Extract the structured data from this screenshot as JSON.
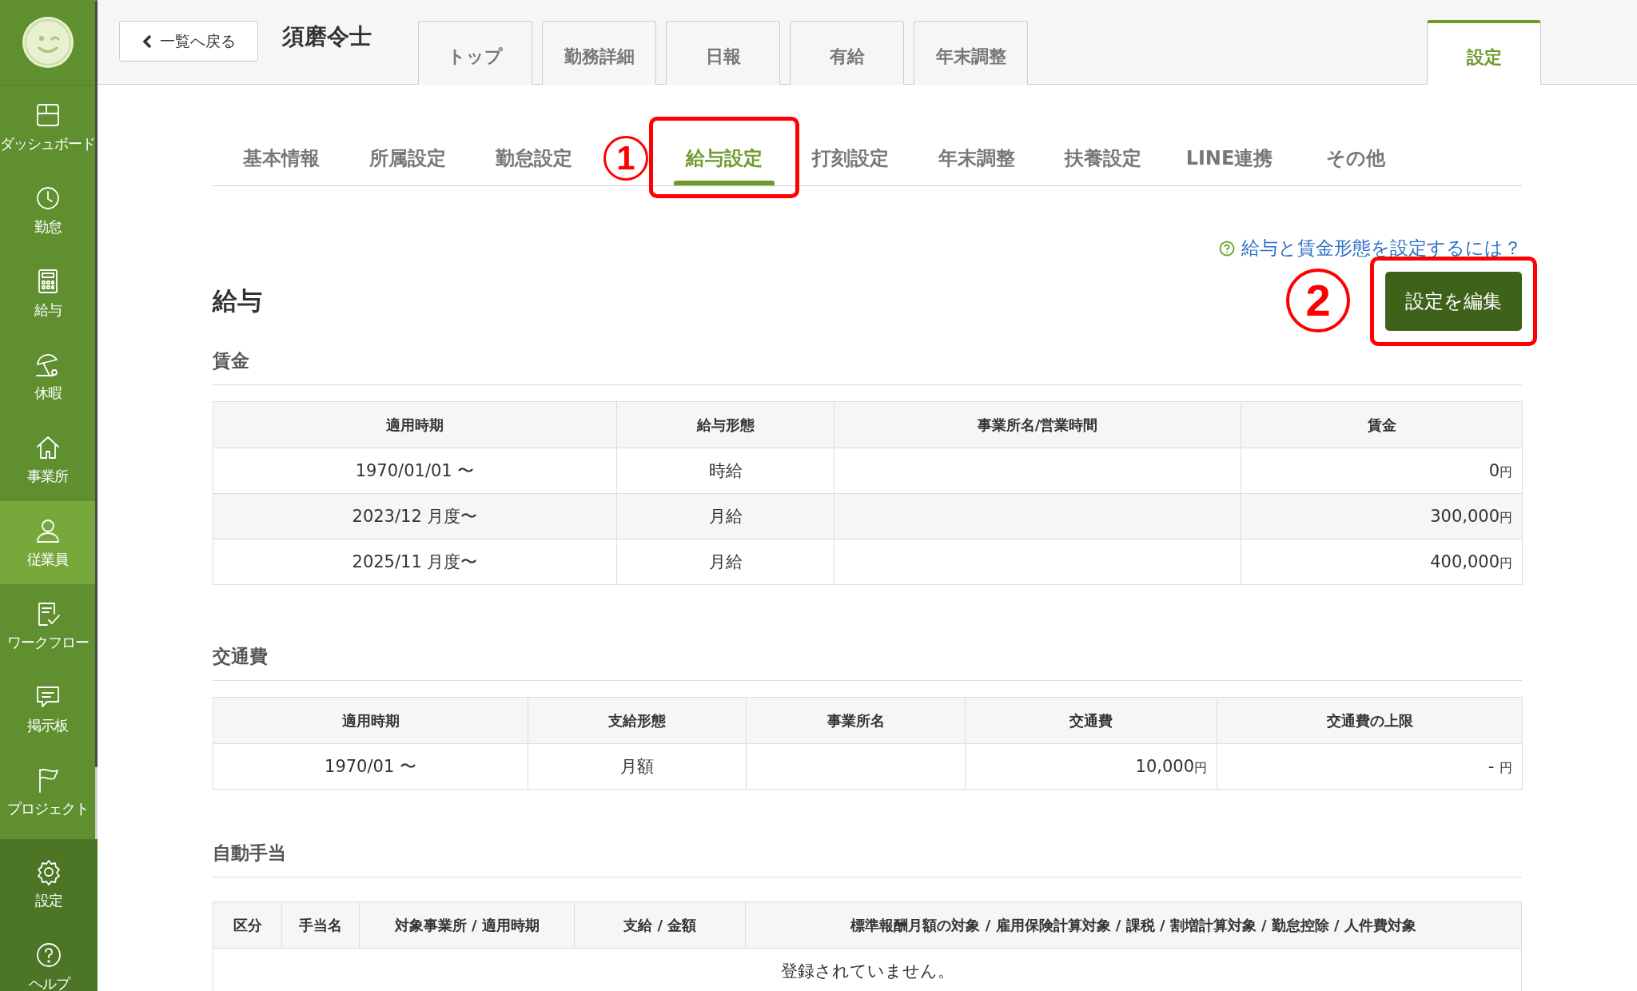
{
  "sidebar": {
    "items": [
      {
        "label": "ダッシュボード",
        "selected": false
      },
      {
        "label": "勤怠",
        "selected": false
      },
      {
        "label": "給与",
        "selected": false
      },
      {
        "label": "休暇",
        "selected": false
      },
      {
        "label": "事業所",
        "selected": false
      },
      {
        "label": "従業員",
        "selected": true
      },
      {
        "label": "ワークフロー",
        "selected": false
      },
      {
        "label": "掲示板",
        "selected": false
      },
      {
        "label": "プロジェクト",
        "selected": false
      }
    ],
    "footer_items": [
      {
        "label": "設定"
      },
      {
        "label": "ヘルプ"
      }
    ]
  },
  "header": {
    "back_button": "一覧へ戻る",
    "employee_name": "須磨令士",
    "tabs": [
      {
        "label": "トップ",
        "selected": false
      },
      {
        "label": "勤務詳細",
        "selected": false
      },
      {
        "label": "日報",
        "selected": false
      },
      {
        "label": "有給",
        "selected": false
      },
      {
        "label": "年末調整",
        "selected": false
      }
    ],
    "settings_tab": {
      "label": "設定",
      "selected": true
    }
  },
  "sub_tabs": [
    {
      "label": "基本情報",
      "selected": false
    },
    {
      "label": "所属設定",
      "selected": false
    },
    {
      "label": "勤怠設定",
      "selected": false
    },
    {
      "label": "給与設定",
      "selected": true
    },
    {
      "label": "打刻設定",
      "selected": false
    },
    {
      "label": "年末調整",
      "selected": false
    },
    {
      "label": "扶養設定",
      "selected": false
    },
    {
      "label": "LINE連携",
      "selected": false
    },
    {
      "label": "その他",
      "selected": false
    }
  ],
  "annotations": [
    {
      "label": "1"
    },
    {
      "label": "2"
    }
  ],
  "help_link": "給与と賃金形態を設定するには？",
  "edit_button": "設定を編集",
  "title": "給与",
  "wage": {
    "heading": "賃金",
    "columns": [
      "適用時期",
      "給与形態",
      "事業所名/営業時間",
      "賃金"
    ],
    "rows": [
      {
        "period": "1970/01/01 〜",
        "type": "時給",
        "office": "",
        "amount": "0",
        "unit": "円"
      },
      {
        "period": "2023/12 月度〜",
        "type": "月給",
        "office": "",
        "amount": "300,000",
        "unit": "円"
      },
      {
        "period": "2025/11 月度〜",
        "type": "月給",
        "office": "",
        "amount": "400,000",
        "unit": "円"
      }
    ]
  },
  "transport": {
    "heading": "交通費",
    "columns": [
      "適用時期",
      "支給形態",
      "事業所名",
      "交通費",
      "交通費の上限"
    ],
    "rows": [
      {
        "period": "1970/01 〜",
        "type": "月額",
        "office": "",
        "amount": "10,000",
        "unit": "円",
        "limit": "-",
        "limit_unit": "円"
      }
    ]
  },
  "allowance": {
    "heading": "自動手当",
    "columns": [
      "区分",
      "手当名",
      "対象事業所 / 適用時期",
      "支給 / 金額",
      "標準報酬月額の対象 / 雇用保険計算対象 / 課税 / 割増計算対象 / 勤怠控除 / 人件費対象"
    ],
    "empty_message": "登録されていません。"
  }
}
